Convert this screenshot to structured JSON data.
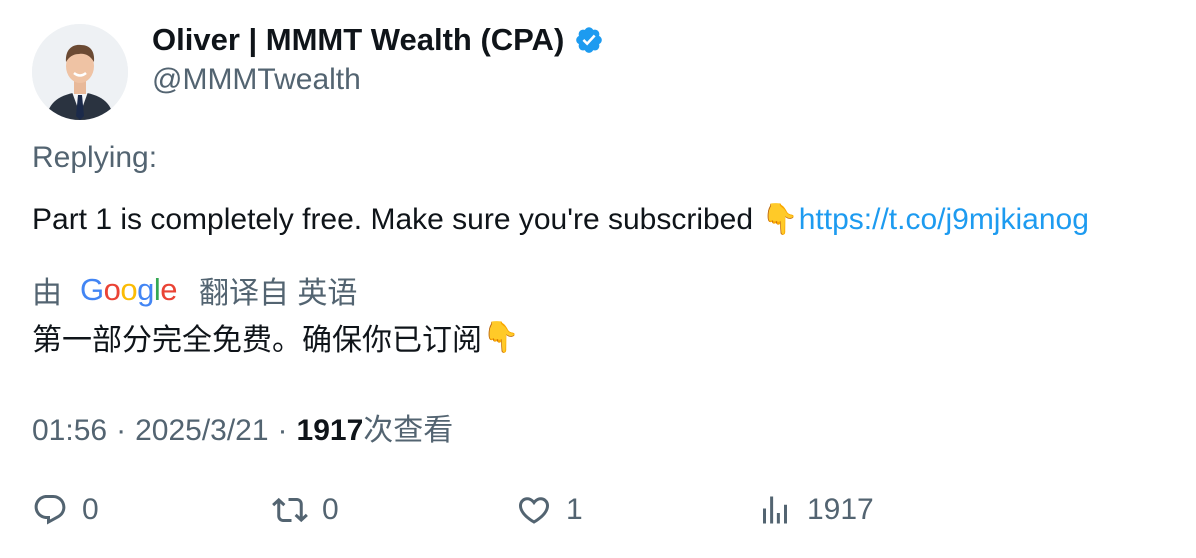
{
  "author": {
    "display_name": "Oliver | MMMT Wealth (CPA)",
    "handle": "@MMMTwealth",
    "verified": true,
    "avatar_icon": "avatar-photo",
    "badge_color": "#1d9bf0"
  },
  "tweet": {
    "replying_label": "Replying:",
    "text": "Part 1 is completely free. Make sure you're subscribed ",
    "emoji": "👇",
    "link": "https://t.co/j9mjkianog",
    "link_color": "#1d9bf0"
  },
  "translation": {
    "by_label": "由",
    "provider": "Google",
    "from_label": "翻译自 英语",
    "text": "第一部分完全免费。确保你已订阅",
    "emoji": "👇"
  },
  "meta": {
    "time": "01:56",
    "separator": "·",
    "date": "2025/3/21",
    "views_count": "1917",
    "views_label": "次查看"
  },
  "actions": {
    "reply": {
      "icon": "reply-icon",
      "count": "0"
    },
    "retweet": {
      "icon": "retweet-icon",
      "count": "0"
    },
    "like": {
      "icon": "heart-icon",
      "count": "1"
    },
    "views": {
      "icon": "views-chart-icon",
      "count": "1917"
    }
  }
}
